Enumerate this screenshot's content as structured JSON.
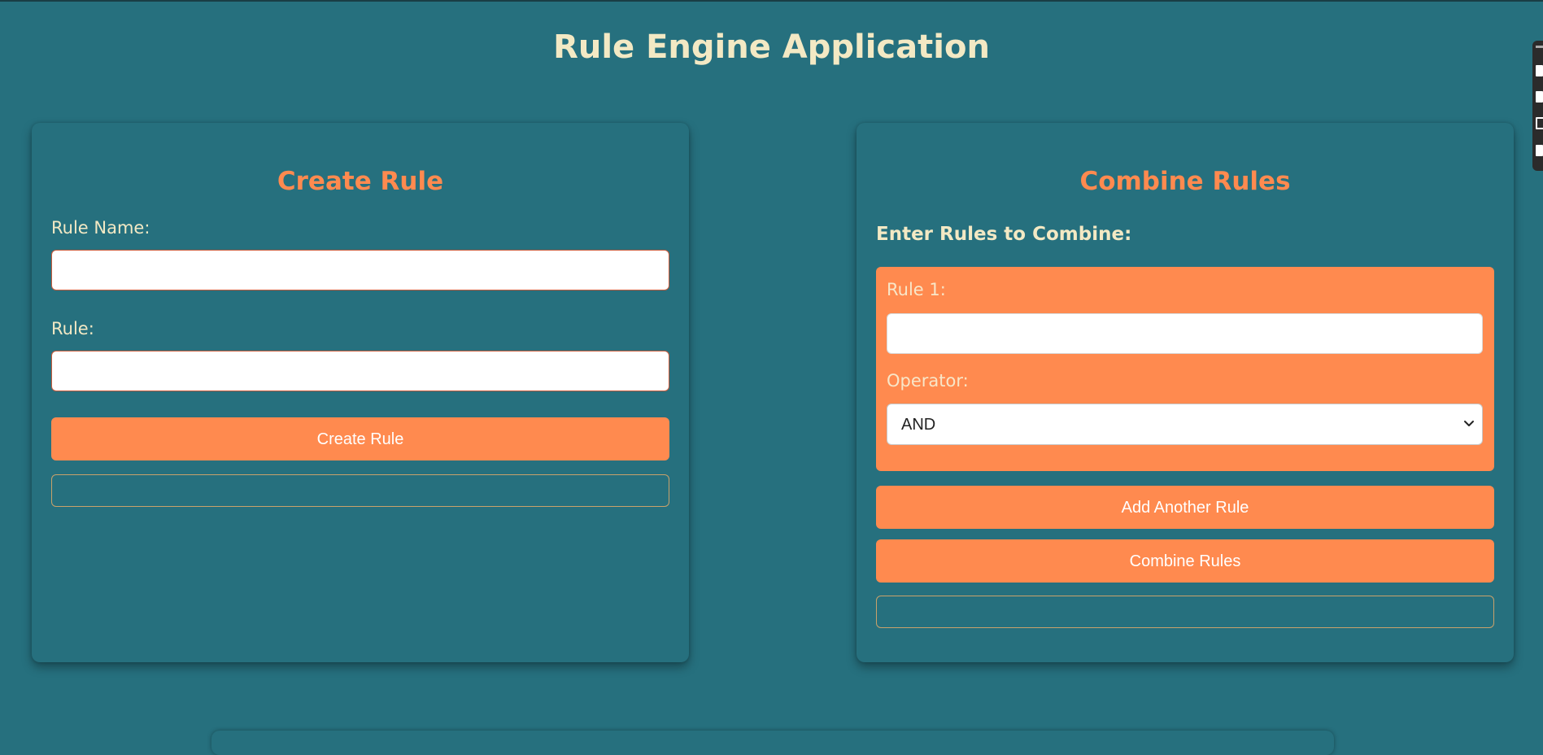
{
  "app": {
    "title": "Rule Engine Application"
  },
  "create_rule": {
    "title": "Create Rule",
    "rule_name_label": "Rule Name:",
    "rule_name_value": "",
    "rule_label": "Rule:",
    "rule_value": "",
    "submit_label": "Create Rule",
    "result_text": ""
  },
  "combine_rules": {
    "title": "Combine Rules",
    "subheading": "Enter Rules to Combine:",
    "rules": [
      {
        "label": "Rule 1:",
        "value": "",
        "operator_label": "Operator:",
        "operator_value": "AND"
      }
    ],
    "add_label": "Add Another Rule",
    "combine_label": "Combine Rules",
    "result_text": ""
  },
  "icons": {
    "select_chevron": "chevron-down-icon"
  },
  "colors": {
    "background": "#26707e",
    "accent": "#ff8a4f",
    "title_text": "#f3e9c4"
  }
}
